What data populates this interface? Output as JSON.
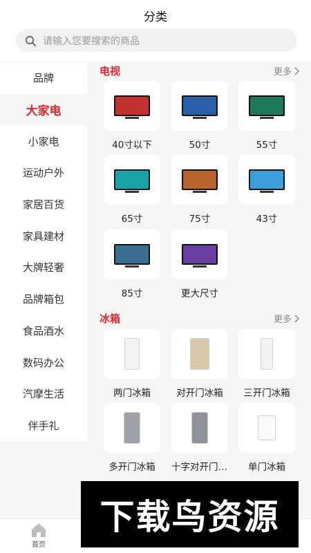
{
  "header": {
    "title": "分类",
    "search_placeholder": "请输入您要搜索的商品"
  },
  "sidebar": {
    "items": [
      {
        "label": "品牌"
      },
      {
        "label": "大家电"
      },
      {
        "label": "小家电"
      },
      {
        "label": "运动户外"
      },
      {
        "label": "家居百货"
      },
      {
        "label": "家具建材"
      },
      {
        "label": "大牌轻奢"
      },
      {
        "label": "品牌箱包"
      },
      {
        "label": "食品酒水"
      },
      {
        "label": "数码办公"
      },
      {
        "label": "汽摩生活"
      },
      {
        "label": "伴手礼"
      }
    ],
    "active_index": 1
  },
  "sections": [
    {
      "title": "电视",
      "more": "更多",
      "items": [
        {
          "label": "40寸以下",
          "screen": "#c2322f"
        },
        {
          "label": "50寸",
          "screen": "#2b5fa8"
        },
        {
          "label": "55寸",
          "screen": "#1f7a5a"
        },
        {
          "label": "65寸",
          "screen": "#17a3a8"
        },
        {
          "label": "75寸",
          "screen": "#b8642c"
        },
        {
          "label": "43寸",
          "screen": "#3a9fd8"
        },
        {
          "label": "85寸",
          "screen": "#3b6f8f"
        },
        {
          "label": "更大尺寸",
          "screen": "#6b3fa0"
        }
      ]
    },
    {
      "title": "冰箱",
      "more": "更多",
      "items": [
        {
          "label": "两门冰箱",
          "body": "#f3f3f3"
        },
        {
          "label": "对开门冰箱",
          "body": "#d9c7a8"
        },
        {
          "label": "三开门冰箱",
          "body": "#f2f2f2"
        },
        {
          "label": "多开门冰箱",
          "body": "#9ea2a8"
        },
        {
          "label": "十字对开门冰箱",
          "body": "#8e9298"
        },
        {
          "label": "单门冰箱",
          "body": "#fafafa"
        }
      ]
    }
  ],
  "tabbar": {
    "home_label": "首页"
  },
  "watermark": {
    "text": "下载鸟资源"
  }
}
